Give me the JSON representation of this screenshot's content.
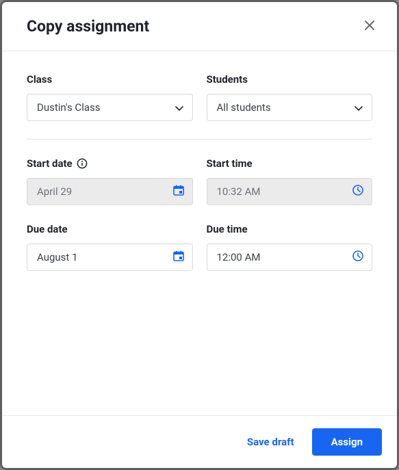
{
  "header": {
    "title": "Copy assignment"
  },
  "fields": {
    "class": {
      "label": "Class",
      "value": "Dustin's Class"
    },
    "students": {
      "label": "Students",
      "value": "All students"
    },
    "start_date": {
      "label": "Start date",
      "value": "April 29"
    },
    "start_time": {
      "label": "Start time",
      "value": "10:32 AM"
    },
    "due_date": {
      "label": "Due date",
      "value": "August 1"
    },
    "due_time": {
      "label": "Due time",
      "value": "12:00 AM"
    }
  },
  "footer": {
    "save_draft": "Save draft",
    "assign": "Assign"
  }
}
